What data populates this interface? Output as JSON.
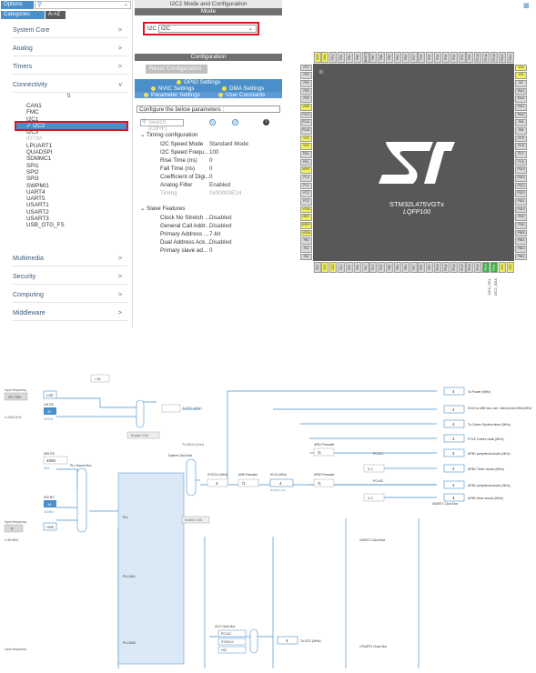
{
  "sidebar": {
    "options_label": "Options",
    "categories_label": "Categories",
    "az_label": "A->Z",
    "categories": [
      {
        "label": "System Core",
        "chev": ">"
      },
      {
        "label": "Analog",
        "chev": ">"
      },
      {
        "label": "Timers",
        "chev": ">"
      },
      {
        "label": "Connectivity",
        "chev": "v"
      },
      {
        "label": "Multimedia",
        "chev": ">"
      },
      {
        "label": "Security",
        "chev": ">"
      },
      {
        "label": "Computing",
        "chev": ">"
      },
      {
        "label": "Middleware",
        "chev": ">"
      }
    ],
    "connectivity_items": [
      "CAN1",
      "FMC",
      "I2C1",
      "I2C2",
      "I2C3",
      "IRTIM",
      "LPUART1",
      "QUADSPI",
      "SDMMC1",
      "SPI1",
      "SPI2",
      "SPI3",
      "SWPMI1",
      "UART4",
      "UART5",
      "USART1",
      "USART2",
      "USART3",
      "USB_OTG_FS"
    ],
    "selected_item": "I2C2"
  },
  "mode_panel": {
    "header": "I2C2 Mode and Configuration",
    "mode_bar": "Mode",
    "i2c_label": "I2C",
    "i2c_value": "I2C",
    "config_bar": "Configuration",
    "reset_button": "Reset Configuration",
    "tab_gpio": "GPIO Settings",
    "tab_nvic": "NVIC Settings",
    "tab_dma": "DMA Settings",
    "tab_params": "Parameter Settings",
    "tab_user": "User Constants",
    "configure_text": "Configure the below parameters :",
    "search_placeholder": "Search (Crtl+F)",
    "group_timing": "Timing configuration",
    "group_slave": "Slave Features",
    "params": [
      {
        "k": "I2C Speed Mode",
        "v": "Standard Mode",
        "grey": false
      },
      {
        "k": "I2C Speed Frequ...",
        "v": "100",
        "grey": false
      },
      {
        "k": "Rise Time (ns)",
        "v": "0",
        "grey": false
      },
      {
        "k": "Fall Time (ns)",
        "v": "0",
        "grey": false
      },
      {
        "k": "Coefficient of Digi...",
        "v": "0",
        "grey": false
      },
      {
        "k": "Analog Filter",
        "v": "Enabled",
        "grey": false
      },
      {
        "k": "Timing",
        "v": "0x00000E14",
        "grey": true
      }
    ],
    "slave_params": [
      {
        "k": "Clock No Stretch ...",
        "v": "Disabled"
      },
      {
        "k": "General Call Addr...",
        "v": "Disabled"
      },
      {
        "k": "Primary Address ...",
        "v": "7-bit"
      },
      {
        "k": "Dual Address Ack...",
        "v": "Disabled"
      },
      {
        "k": "Primary slave ad...",
        "v": "0"
      }
    ]
  },
  "chip": {
    "name": "STM32L475VGTx",
    "package": "LQFP100",
    "pin_labels": [
      "I2C2_SCL",
      "I2C2_SDA"
    ],
    "left_pins": [
      "PE2",
      "PE3",
      "PE4",
      "PE5",
      "PE6",
      "VBAT",
      "PC13",
      "PC14-",
      "PC15-",
      "VSS",
      "VDD",
      "PH0-",
      "PH1-",
      "NRST",
      "PC0",
      "PC1",
      "PC2",
      "PC3",
      "VSSA",
      "VREF-",
      "VREF+",
      "VDDA",
      "PA0",
      "PA1",
      "PA2"
    ],
    "right_pins": [
      "VDD",
      "VSS",
      "NC",
      "PA13",
      "PA12",
      "PA11",
      "PA10",
      "PA9",
      "PA8",
      "PC9",
      "PC8",
      "PC7",
      "PC6",
      "PD15",
      "PD14",
      "PD13",
      "PD12",
      "PD11",
      "PD10",
      "PD9",
      "PD8",
      "PB15",
      "PB14",
      "PB13",
      "PB12"
    ],
    "top_pins": [
      "VDD",
      "VSS",
      "PE1",
      "PE0",
      "PB9",
      "PB8",
      "BOOT0",
      "PB7",
      "PB6",
      "PB5",
      "PB4",
      "PB3",
      "PD7",
      "PD6",
      "PD5",
      "PD4",
      "PD3",
      "PD2",
      "PD1",
      "PD0",
      "PC12",
      "PC11",
      "PC10",
      "PA15",
      "PA14"
    ],
    "bottom_pins": [
      "PA3",
      "VSS",
      "VDD",
      "PA4",
      "PA5",
      "PA6",
      "PA7",
      "PC4",
      "PC5",
      "PB0",
      "PB1",
      "PB2",
      "PE7",
      "PE8",
      "PE9",
      "PE10",
      "PE11",
      "PE12",
      "PE13",
      "PE14",
      "PE15",
      "PB10",
      "PB11",
      "VSS",
      "VDD"
    ]
  },
  "clock": {
    "input_frequency": "Input frequency",
    "lse_value": "32.768",
    "lse_range": "0-1000 KHz",
    "lse_label": "LSE",
    "lsi_rc": "LSI RC",
    "lsi_val": "32",
    "lsi_unit": "32 KHz",
    "msi_rc": "MSI RC",
    "msi_val": "4000",
    "msi_unit": "KHz",
    "hsi_rc": "HSI RC",
    "hsi_val": "16",
    "hsi_unit": "16 MHz",
    "hse_label": "HSE",
    "hse_val": "8",
    "hse_range": "4-48 MHz",
    "pll_source_mux": "PLL Source Mux",
    "pll_label": "PLL",
    "pllsai1": "PLLSAI1",
    "pllsai2": "PLLSAI2",
    "system_clock_mux": "System Clock Mux",
    "sysclk_label": "SYSCLK (MHz)",
    "sysclk_val": "4",
    "ahb_prescaler": "AHB Prescaler",
    "ahb_val": "/1",
    "hclk_label": "HCLK (MHz)",
    "hclk_val": "4",
    "hclk_max": "80 MHz max",
    "apb1_prescaler": "APB1 Prescaler",
    "apb2_prescaler": "APB2 Prescaler",
    "pclk1": "PCLK1",
    "pclk2": "PCLK2",
    "apb_div": "/1",
    "x1": "X 1",
    "enable_css": "Enable CSS",
    "lse_css": "Enable CSS",
    "div32": "/ 32",
    "rtc_label": "To RTC (KHz)",
    "iwdg_label": "To IWDG (KHz)",
    "outputs": [
      {
        "val": "4",
        "label": "To Power (MHz)"
      },
      {
        "val": "4",
        "label": "HCLK to AHB bus, core, memory and DMA (MHz)"
      },
      {
        "val": "4",
        "label": "To Cortex System timer (MHz)"
      },
      {
        "val": "4",
        "label": "FCLK Cortex clock (MHz)"
      },
      {
        "val": "4",
        "label": "APB1 peripheral clocks (MHz)"
      },
      {
        "val": "4",
        "label": "APB1 Timer clocks (MHz)"
      },
      {
        "val": "4",
        "label": "APB2 peripheral clocks (MHz)"
      },
      {
        "val": "4",
        "label": "APB2 timer clocks (MHz)"
      }
    ],
    "i2c2_mux": "I2C2 Clock Mux",
    "to_i2c2": "To I2C2 (MHz)",
    "i2c2_val": "4",
    "usart1_mux": "USART1 Clock Mux",
    "usart2_mux": "USART2 Clock Mux",
    "lpuart1_mux": "LPUART1 Clock Mux",
    "sysclk_mux_lbl": "SYSCLK",
    "hsi_lbl": "HSI",
    "pclk1_lbl": "PCLK1"
  }
}
